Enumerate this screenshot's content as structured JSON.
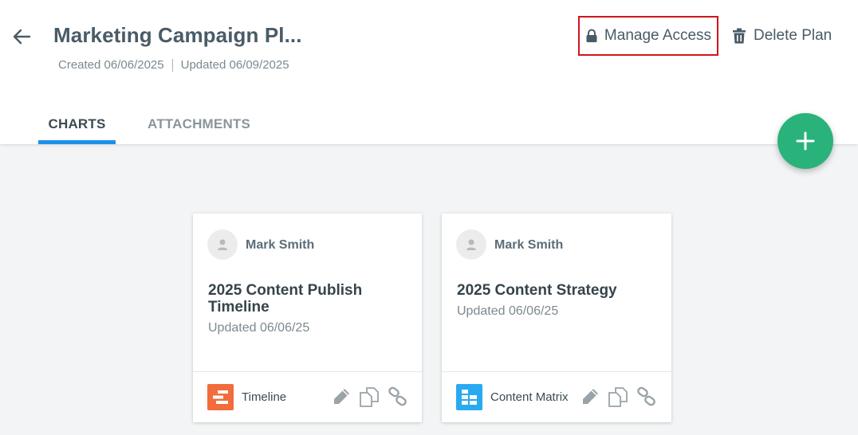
{
  "header": {
    "title": "Marketing Campaign Pl...",
    "created": "Created 06/06/2025",
    "updated": "Updated 06/09/2025",
    "manage_access_label": "Manage Access",
    "delete_plan_label": "Delete Plan"
  },
  "tabs": [
    {
      "label": "CHARTS",
      "active": true
    },
    {
      "label": "ATTACHMENTS",
      "active": false
    }
  ],
  "colors": {
    "accent_tab": "#1e90e8",
    "fab": "#2ab27b",
    "highlight_border": "#d0151c",
    "timeline_icon": "#f26c3d",
    "matrix_icon": "#29aaf0"
  },
  "cards": [
    {
      "owner": "Mark Smith",
      "title": "2025 Content Publish Timeline",
      "updated": "Updated 06/06/25",
      "type_label": "Timeline",
      "type_icon": "timeline-icon"
    },
    {
      "owner": "Mark Smith",
      "title": "2025 Content Strategy",
      "updated": "Updated 06/06/25",
      "type_label": "Content Matrix",
      "type_icon": "content-matrix-icon"
    }
  ],
  "icons": {
    "back": "arrow-left-icon",
    "lock": "lock-icon",
    "trash": "trash-icon",
    "add": "plus-icon",
    "avatar": "user-icon",
    "edit": "pencil-icon",
    "copy": "copy-icon",
    "link": "link-icon"
  }
}
